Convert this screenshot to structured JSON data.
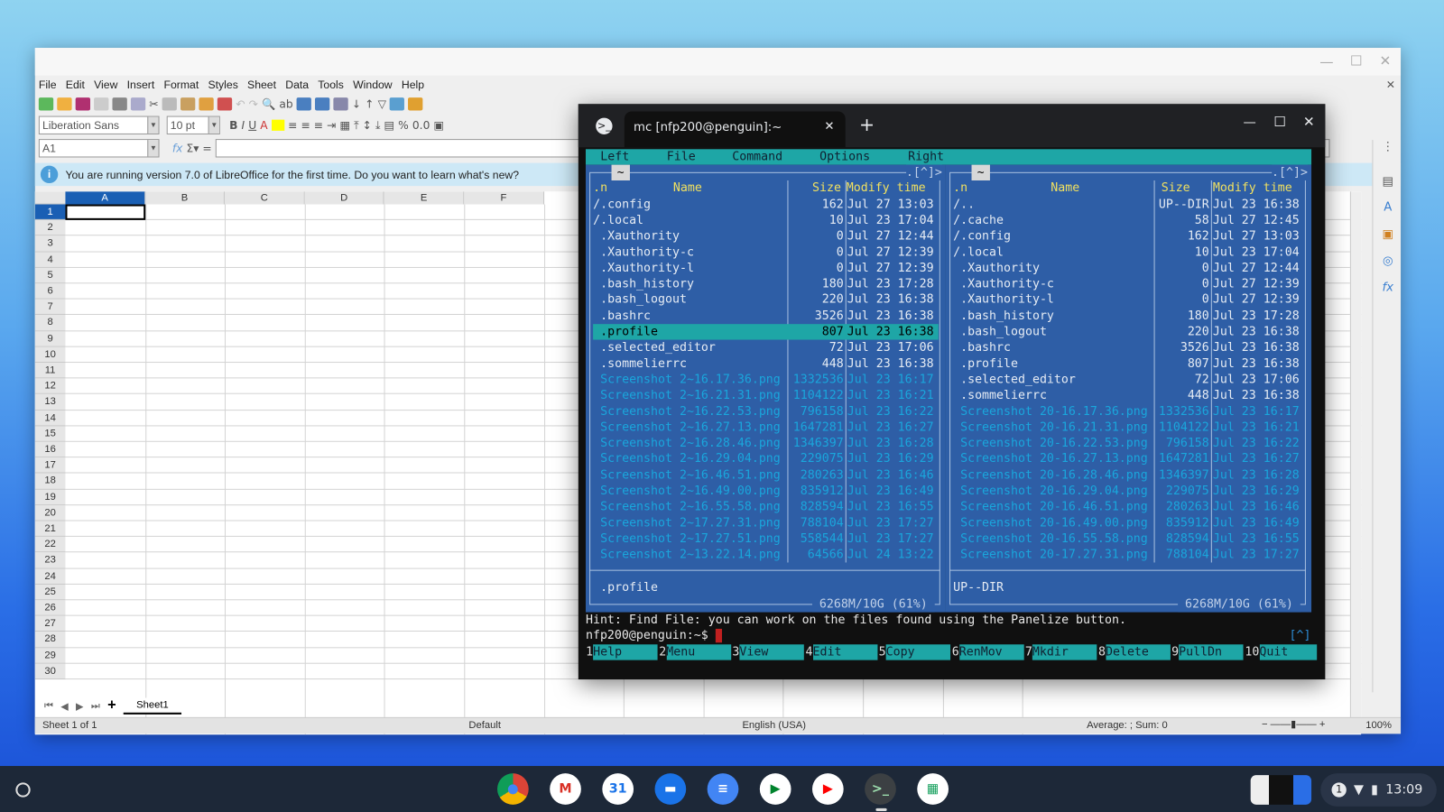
{
  "libreoffice": {
    "menu": [
      "File",
      "Edit",
      "View",
      "Insert",
      "Format",
      "Styles",
      "Sheet",
      "Data",
      "Tools",
      "Window",
      "Help"
    ],
    "font_name": "Liberation Sans",
    "font_size": "10 pt",
    "name_box": "A1",
    "formula": "",
    "info_message": "You are running version 7.0 of LibreOffice for the first time. Do you want to learn what's new?",
    "columns": [
      "A",
      "B",
      "C",
      "D",
      "E",
      "F"
    ],
    "rows": [
      "1",
      "2",
      "3",
      "4",
      "5",
      "6",
      "7",
      "8",
      "9",
      "10",
      "11",
      "12",
      "13",
      "14",
      "15",
      "16",
      "17",
      "18",
      "19",
      "20",
      "21",
      "22",
      "23",
      "24",
      "25",
      "26",
      "27",
      "28",
      "29",
      "30"
    ],
    "active_cell": "A1",
    "sheet_tab": "Sheet1",
    "status": {
      "sheet": "Sheet 1 of 1",
      "style": "Default",
      "language": "English (USA)",
      "summary": "Average: ; Sum: 0",
      "zoom": "100%"
    }
  },
  "terminal": {
    "tab_title": "mc [nfp200@penguin]:~",
    "menu": [
      "Left",
      "File",
      "Command",
      "Options",
      "Right"
    ],
    "left_panel": {
      "path": "~",
      "corner": ".[^]>",
      "headers": {
        "n": ".n",
        "name": "Name",
        "size": "Size",
        "time": "Modify time"
      },
      "selected_index": 8,
      "files": [
        {
          "name": "/.config",
          "size": "162",
          "time": "Jul 27 13:03",
          "kind": "dir"
        },
        {
          "name": "/.local",
          "size": "10",
          "time": "Jul 23 17:04",
          "kind": "dir"
        },
        {
          "name": " .Xauthority",
          "size": "0",
          "time": "Jul 27 12:44",
          "kind": "file"
        },
        {
          "name": " .Xauthority-c",
          "size": "0",
          "time": "Jul 27 12:39",
          "kind": "file"
        },
        {
          "name": " .Xauthority-l",
          "size": "0",
          "time": "Jul 27 12:39",
          "kind": "file"
        },
        {
          "name": " .bash_history",
          "size": "180",
          "time": "Jul 23 17:28",
          "kind": "file"
        },
        {
          "name": " .bash_logout",
          "size": "220",
          "time": "Jul 23 16:38",
          "kind": "file"
        },
        {
          "name": " .bashrc",
          "size": "3526",
          "time": "Jul 23 16:38",
          "kind": "file"
        },
        {
          "name": " .profile",
          "size": "807",
          "time": "Jul 23 16:38",
          "kind": "file"
        },
        {
          "name": " .selected_editor",
          "size": "72",
          "time": "Jul 23 17:06",
          "kind": "file"
        },
        {
          "name": " .sommelierrc",
          "size": "448",
          "time": "Jul 23 16:38",
          "kind": "file"
        },
        {
          "name": " Screenshot 2~16.17.36.png",
          "size": "1332536",
          "time": "Jul 23 16:17",
          "kind": "image"
        },
        {
          "name": " Screenshot 2~16.21.31.png",
          "size": "1104122",
          "time": "Jul 23 16:21",
          "kind": "image"
        },
        {
          "name": " Screenshot 2~16.22.53.png",
          "size": "796158",
          "time": "Jul 23 16:22",
          "kind": "image"
        },
        {
          "name": " Screenshot 2~16.27.13.png",
          "size": "1647281",
          "time": "Jul 23 16:27",
          "kind": "image"
        },
        {
          "name": " Screenshot 2~16.28.46.png",
          "size": "1346397",
          "time": "Jul 23 16:28",
          "kind": "image"
        },
        {
          "name": " Screenshot 2~16.29.04.png",
          "size": "229075",
          "time": "Jul 23 16:29",
          "kind": "image"
        },
        {
          "name": " Screenshot 2~16.46.51.png",
          "size": "280263",
          "time": "Jul 23 16:46",
          "kind": "image"
        },
        {
          "name": " Screenshot 2~16.49.00.png",
          "size": "835912",
          "time": "Jul 23 16:49",
          "kind": "image"
        },
        {
          "name": " Screenshot 2~16.55.58.png",
          "size": "828594",
          "time": "Jul 23 16:55",
          "kind": "image"
        },
        {
          "name": " Screenshot 2~17.27.31.png",
          "size": "788104",
          "time": "Jul 23 17:27",
          "kind": "image"
        },
        {
          "name": " Screenshot 2~17.27.51.png",
          "size": "558544",
          "time": "Jul 23 17:27",
          "kind": "image"
        },
        {
          "name": " Screenshot 2~13.22.14.png",
          "size": "64566",
          "time": "Jul 24 13:22",
          "kind": "image"
        }
      ],
      "mini_status": " .profile",
      "disk": " 6268M/10G (61%) "
    },
    "right_panel": {
      "path": "~",
      "corner": ".[^]>",
      "headers": {
        "n": ".n",
        "name": "Name",
        "size": "Size",
        "time": "Modify time"
      },
      "files": [
        {
          "name": "/..",
          "size": "UP--DIR",
          "time": "Jul 23 16:38",
          "kind": "dir"
        },
        {
          "name": "/.cache",
          "size": "58",
          "time": "Jul 27 12:45",
          "kind": "dir"
        },
        {
          "name": "/.config",
          "size": "162",
          "time": "Jul 27 13:03",
          "kind": "dir"
        },
        {
          "name": "/.local",
          "size": "10",
          "time": "Jul 23 17:04",
          "kind": "dir"
        },
        {
          "name": " .Xauthority",
          "size": "0",
          "time": "Jul 27 12:44",
          "kind": "file"
        },
        {
          "name": " .Xauthority-c",
          "size": "0",
          "time": "Jul 27 12:39",
          "kind": "file"
        },
        {
          "name": " .Xauthority-l",
          "size": "0",
          "time": "Jul 27 12:39",
          "kind": "file"
        },
        {
          "name": " .bash_history",
          "size": "180",
          "time": "Jul 23 17:28",
          "kind": "file"
        },
        {
          "name": " .bash_logout",
          "size": "220",
          "time": "Jul 23 16:38",
          "kind": "file"
        },
        {
          "name": " .bashrc",
          "size": "3526",
          "time": "Jul 23 16:38",
          "kind": "file"
        },
        {
          "name": " .profile",
          "size": "807",
          "time": "Jul 23 16:38",
          "kind": "file"
        },
        {
          "name": " .selected_editor",
          "size": "72",
          "time": "Jul 23 17:06",
          "kind": "file"
        },
        {
          "name": " .sommelierrc",
          "size": "448",
          "time": "Jul 23 16:38",
          "kind": "file"
        },
        {
          "name": " Screenshot 20-16.17.36.png",
          "size": "1332536",
          "time": "Jul 23 16:17",
          "kind": "image"
        },
        {
          "name": " Screenshot 20-16.21.31.png",
          "size": "1104122",
          "time": "Jul 23 16:21",
          "kind": "image"
        },
        {
          "name": " Screenshot 20-16.22.53.png",
          "size": "796158",
          "time": "Jul 23 16:22",
          "kind": "image"
        },
        {
          "name": " Screenshot 20-16.27.13.png",
          "size": "1647281",
          "time": "Jul 23 16:27",
          "kind": "image"
        },
        {
          "name": " Screenshot 20-16.28.46.png",
          "size": "1346397",
          "time": "Jul 23 16:28",
          "kind": "image"
        },
        {
          "name": " Screenshot 20-16.29.04.png",
          "size": "229075",
          "time": "Jul 23 16:29",
          "kind": "image"
        },
        {
          "name": " Screenshot 20-16.46.51.png",
          "size": "280263",
          "time": "Jul 23 16:46",
          "kind": "image"
        },
        {
          "name": " Screenshot 20-16.49.00.png",
          "size": "835912",
          "time": "Jul 23 16:49",
          "kind": "image"
        },
        {
          "name": " Screenshot 20-16.55.58.png",
          "size": "828594",
          "time": "Jul 23 16:55",
          "kind": "image"
        },
        {
          "name": " Screenshot 20-17.27.31.png",
          "size": "788104",
          "time": "Jul 23 17:27",
          "kind": "image"
        }
      ],
      "mini_status": "UP--DIR",
      "disk": " 6268M/10G (61%) "
    },
    "hint": "Hint: Find File: you can work on the files found using the Panelize button.",
    "prompt": "nfp200@penguin:~$ ",
    "prompt_corner": "[^]",
    "fkeys": [
      {
        "n": "1",
        "label": "Help"
      },
      {
        "n": "2",
        "label": "Menu"
      },
      {
        "n": "3",
        "label": "View"
      },
      {
        "n": "4",
        "label": "Edit"
      },
      {
        "n": "5",
        "label": "Copy"
      },
      {
        "n": "6",
        "label": "RenMov"
      },
      {
        "n": "7",
        "label": "Mkdir"
      },
      {
        "n": "8",
        "label": "Delete"
      },
      {
        "n": "9",
        "label": "PullDn"
      },
      {
        "n": "10",
        "label": "Quit"
      }
    ],
    "colors": {
      "panel": "#2e5ea6",
      "accent": "#1ea6a6",
      "header": "#f0e060",
      "image_file": "#1aa6dc"
    }
  },
  "shelf": {
    "apps": [
      "chrome-icon",
      "gmail-icon",
      "calendar-icon",
      "files-icon",
      "docs-icon",
      "meet-icon",
      "youtube-icon",
      "terminal-icon",
      "sheets-icon"
    ],
    "notification_count": "1",
    "clock": "13:09"
  }
}
